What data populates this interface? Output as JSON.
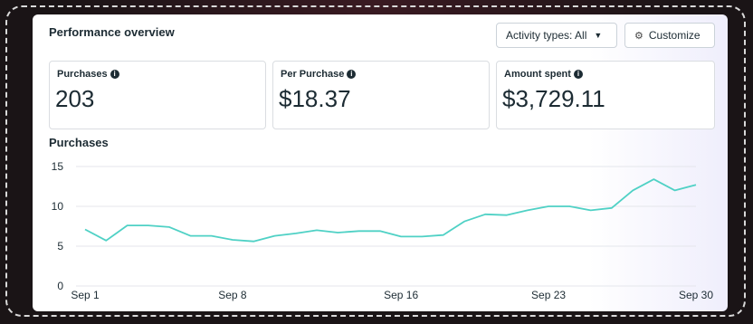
{
  "header": {
    "title": "Performance overview",
    "activity_filter": "Activity types: All",
    "customize_label": "Customize"
  },
  "metrics": [
    {
      "label": "Purchases",
      "value": "203"
    },
    {
      "label": "Per Purchase",
      "value": "$18.37"
    },
    {
      "label": "Amount spent",
      "value": "$3,729.11"
    }
  ],
  "chart_title": "Purchases",
  "chart_data": {
    "type": "line",
    "title": "Purchases",
    "xlabel": "",
    "ylabel": "",
    "ylim": [
      0,
      15
    ],
    "yticks": [
      0,
      5,
      10,
      15
    ],
    "xticks": [
      {
        "day": 1,
        "label": "Sep 1"
      },
      {
        "day": 8,
        "label": "Sep 8"
      },
      {
        "day": 16,
        "label": "Sep 16"
      },
      {
        "day": 23,
        "label": "Sep 23"
      },
      {
        "day": 30,
        "label": "Sep 30"
      }
    ],
    "grid": true,
    "color": "#4fd1c5",
    "series": [
      {
        "x": [
          1,
          2,
          3,
          4,
          5,
          6,
          7,
          8,
          9,
          10,
          11,
          12,
          13,
          14,
          15,
          16,
          17,
          18,
          19,
          20,
          21,
          22,
          23,
          24,
          25,
          26,
          27,
          28,
          29,
          30
        ],
        "values": [
          7.1,
          5.7,
          7.6,
          7.6,
          7.4,
          6.3,
          6.3,
          5.8,
          5.6,
          6.3,
          6.6,
          7.0,
          6.7,
          6.9,
          6.9,
          6.2,
          6.2,
          6.4,
          8.1,
          9.0,
          8.9,
          9.5,
          10.0,
          10.0,
          9.5,
          9.8,
          12.0,
          13.4,
          12.0,
          12.7
        ]
      }
    ]
  }
}
